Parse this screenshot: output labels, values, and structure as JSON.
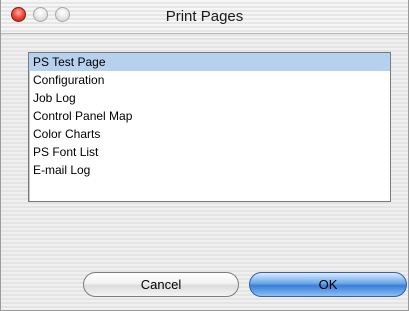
{
  "window": {
    "title": "Print Pages",
    "controls": {
      "close_icon": "close-traffic-light-icon",
      "minimize_icon": "minimize-traffic-light-icon",
      "zoom_icon": "zoom-traffic-light-icon"
    }
  },
  "list": {
    "items": [
      {
        "label": "PS Test Page",
        "selected": true
      },
      {
        "label": "Configuration",
        "selected": false
      },
      {
        "label": "Job Log",
        "selected": false
      },
      {
        "label": "Control Panel Map",
        "selected": false
      },
      {
        "label": "Color Charts",
        "selected": false
      },
      {
        "label": "PS Font List",
        "selected": false
      },
      {
        "label": "E-mail Log",
        "selected": false
      }
    ]
  },
  "buttons": {
    "cancel_label": "Cancel",
    "ok_label": "OK"
  },
  "colors": {
    "selection": "#b5d1ee",
    "default_button": "#3a7ed8",
    "close_button": "#f05040"
  }
}
